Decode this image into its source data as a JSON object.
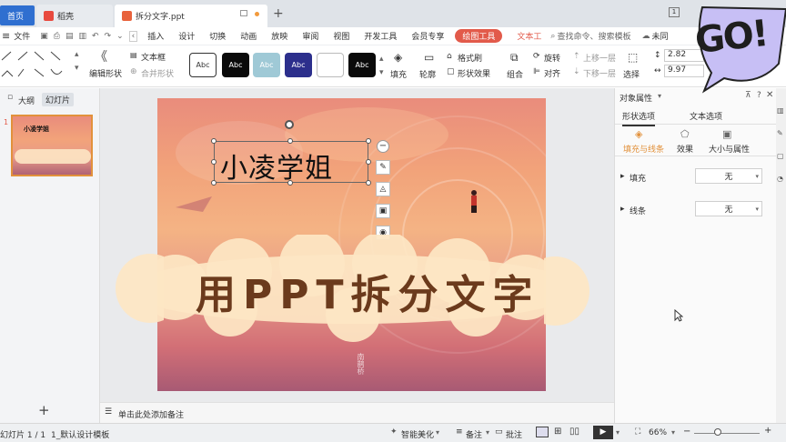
{
  "tabs": {
    "home": "首页",
    "wps": "稻壳",
    "doc": "拆分文字.ppt",
    "add": "+"
  },
  "menu": {
    "file": "文件",
    "items": [
      "插入",
      "设计",
      "切换",
      "动画",
      "放映",
      "审阅",
      "视图",
      "开发工具",
      "会员专享"
    ],
    "drawing_tools": "绘图工具",
    "text_tools": "文本工",
    "search": "查找命令、搜索模板",
    "unsaved": "未同"
  },
  "ribbon": {
    "edit_shape": "编辑形状",
    "text_box": "文本框",
    "merge_shape": "合并形状",
    "style_label": "Abc",
    "fill": "填充",
    "outline": "轮廓",
    "format_painter": "格式刷",
    "shape_effect": "形状效果",
    "group": "组合",
    "rotate": "旋转",
    "align": "对齐",
    "bring_forward": "上移一层",
    "send_backward": "下移一层",
    "select": "选择",
    "height": "2.82",
    "width": "9.97"
  },
  "left_panel": {
    "outline_tab": "大纲",
    "slides_tab": "幻灯片",
    "slide_number": "1",
    "thumb_title": "小凌学姐",
    "add_slide": "+"
  },
  "slide": {
    "textbox_title": "小凌学姐",
    "banner_text": "用PPT拆分文字",
    "signature": "南鹊桥"
  },
  "notes": {
    "placeholder": "单击此处添加备注"
  },
  "right_panel": {
    "title": "对象属性",
    "tab_shape": "形状选项",
    "tab_text": "文本选项",
    "sub_fill_line": "填充与线条",
    "sub_effect": "效果",
    "sub_size": "大小与属性",
    "fill_label": "填充",
    "fill_value": "无",
    "line_label": "线条",
    "line_value": "无"
  },
  "status": {
    "slide_info": "幻灯片 1 / 1",
    "template": "1_默认设计模板",
    "smart_beautify": "智能美化",
    "notes": "备注",
    "comments": "批注",
    "zoom": "66%"
  },
  "overlay": {
    "sticker": "GO!"
  },
  "colors": {
    "accent_blue": "#2f6fd0",
    "drawing_tools_red": "#e25a4a",
    "banner_text": "#6b3a1c",
    "cloud": "#fde6c4"
  }
}
